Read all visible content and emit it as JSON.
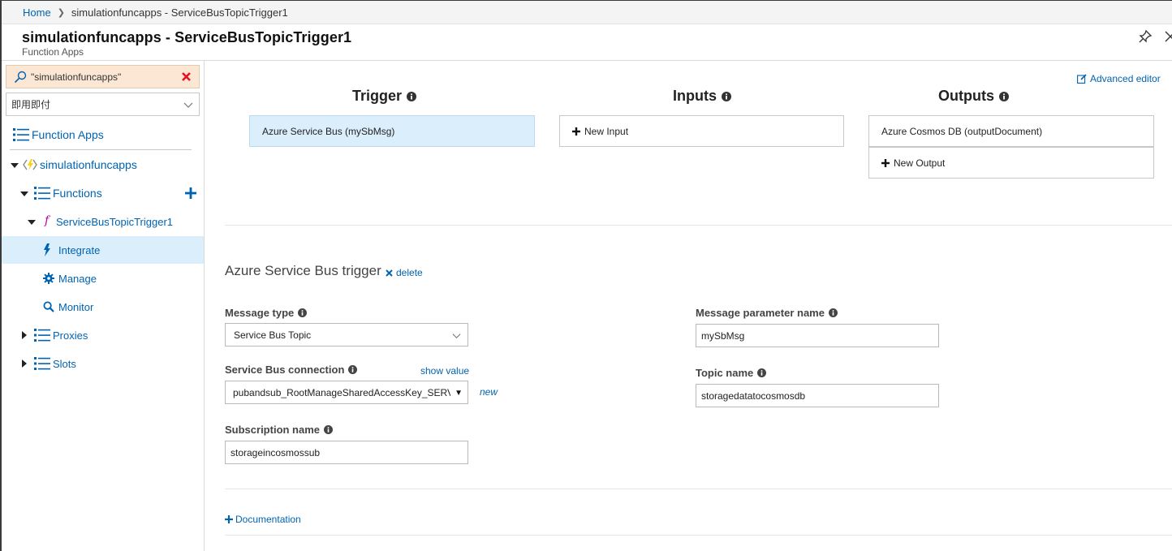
{
  "breadcrumb": {
    "home": "Home",
    "current": "simulationfuncapps - ServiceBusTopicTrigger1"
  },
  "header": {
    "title": "simulationfuncapps - ServiceBusTopicTrigger1",
    "subtitle": "Function Apps"
  },
  "sidebar": {
    "search_value": "\"simulationfuncapps\"",
    "filter_value": "即用即付",
    "items": {
      "function_apps": "Function Apps",
      "app": "simulationfuncapps",
      "functions": "Functions",
      "function": "ServiceBusTopicTrigger1",
      "integrate": "Integrate",
      "manage": "Manage",
      "monitor": "Monitor",
      "proxies": "Proxies",
      "slots": "Slots"
    }
  },
  "main": {
    "advanced_editor": "Advanced editor",
    "columns": {
      "trigger": "Trigger",
      "inputs": "Inputs",
      "outputs": "Outputs"
    },
    "trigger_binding": "Azure Service Bus (mySbMsg)",
    "new_input": "New Input",
    "output_binding": "Azure Cosmos DB (outputDocument)",
    "new_output": "New Output",
    "section_title": "Azure Service Bus trigger",
    "delete": "delete",
    "fields": {
      "message_type_label": "Message type",
      "message_type_value": "Service Bus Topic",
      "connection_label": "Service Bus connection",
      "show_value": "show value",
      "connection_value": "pubandsub_RootManageSharedAccessKey_SERVIC",
      "new": "new",
      "subscription_label": "Subscription name",
      "subscription_value": "storageincosmossub",
      "param_label": "Message parameter name",
      "param_value": "mySbMsg",
      "topic_label": "Topic name",
      "topic_value": "storagedatatocosmosdb"
    },
    "documentation": "Documentation"
  },
  "colors": {
    "link": "#0063b1",
    "selected_bg": "#dbeefc",
    "search_bg": "#fce7d4",
    "delete_red": "#e81123"
  }
}
